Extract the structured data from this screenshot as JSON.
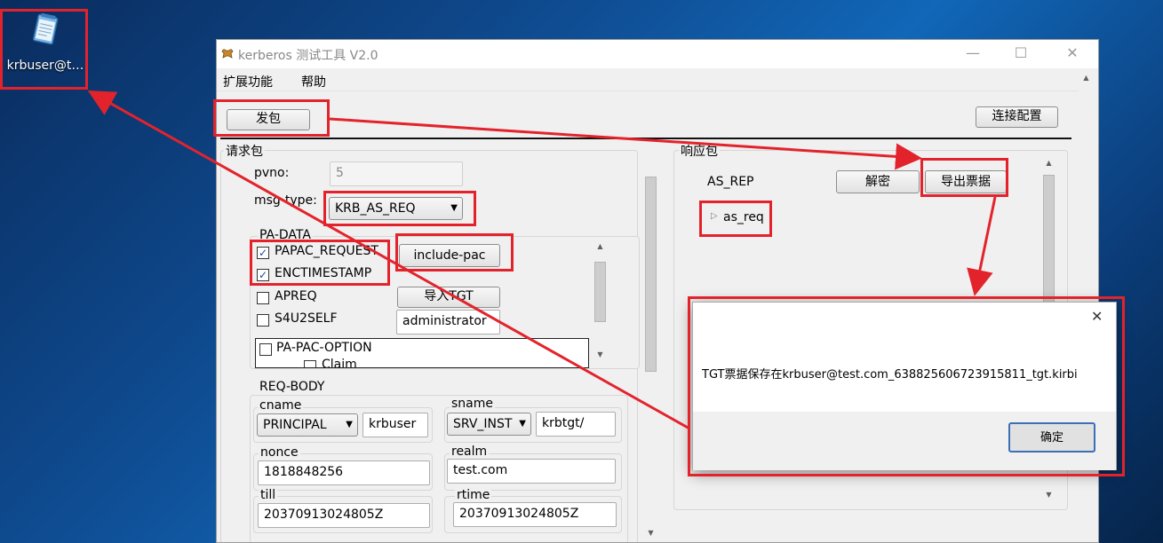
{
  "desktop": {
    "icon_label": "krbuser@t…",
    "icon": "notepad-document-icon"
  },
  "window": {
    "title": "kerberos 测试工具 V2.0",
    "app_icon": "bull-logo-icon",
    "controls": {
      "minimize": "—",
      "maximize": "☐",
      "close": "✕"
    },
    "menu": [
      "扩展功能",
      "帮助"
    ]
  },
  "toolbar": {
    "send_label": "发包",
    "conn_config_label": "连接配置"
  },
  "request": {
    "group_label": "请求包",
    "pvno_label": "pvno:",
    "pvno_value": "5",
    "msg_type_label": "msg-type:",
    "msg_type_value": "KRB_AS_REQ",
    "pa_data": {
      "label": "PA-DATA",
      "items": [
        {
          "label": "PAPAC_REQUEST",
          "checked": true
        },
        {
          "label": "ENCTIMESTAMP",
          "checked": true
        },
        {
          "label": "APREQ",
          "checked": false
        },
        {
          "label": "S4U2SELF",
          "checked": false
        }
      ],
      "include_pac_label": "include-pac",
      "import_tgt_label": "导入TGT",
      "s4u_user": "administrator",
      "pac_option_label": "PA-PAC-OPTION",
      "claim_label": "Claim"
    },
    "req_body": {
      "label": "REQ-BODY",
      "cname_label": "cname",
      "cname_type": "PRINCIPAL",
      "cname_value": "krbuser",
      "sname_label": "sname",
      "sname_type": "SRV_INST",
      "sname_value": "krbtgt/",
      "nonce_label": "nonce",
      "nonce_value": "1818848256",
      "realm_label": "realm",
      "realm_value": "test.com",
      "till_label": "till",
      "till_value": "20370913024805Z",
      "rtime_label": "rtime",
      "rtime_value": "20370913024805Z"
    }
  },
  "response": {
    "group_label": "响应包",
    "type_label": "AS_REP",
    "decrypt_label": "解密",
    "export_label": "导出票据",
    "tree_item": "as_req"
  },
  "dialog": {
    "message": "TGT票据保存在krbuser@test.com_638825606723915811_tgt.kirbi",
    "ok_label": "确定",
    "close": "✕"
  },
  "colors": {
    "annotation": "#e3232c",
    "desktop": "#0f4d93"
  }
}
